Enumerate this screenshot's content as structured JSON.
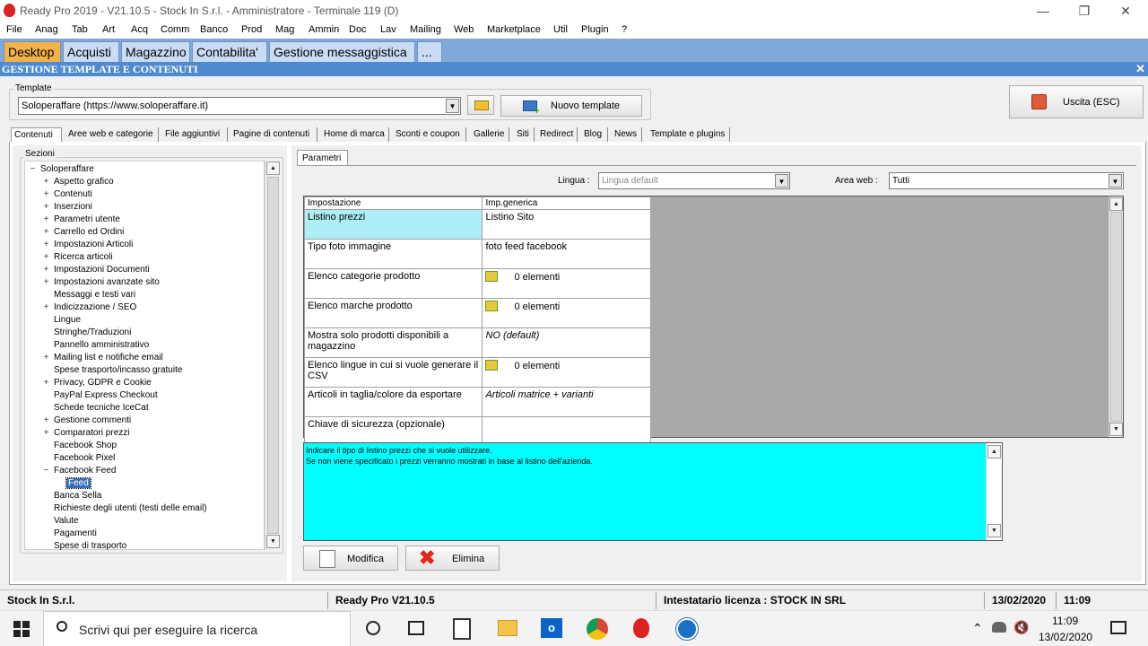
{
  "window": {
    "title": "Ready Pro 2019 - V21.10.5 - Stock In S.r.l. - Amministratore - Terminale 119 (D)",
    "controls": [
      "—",
      "❐",
      "✕"
    ]
  },
  "menu": [
    "File",
    "Anag",
    "Tab",
    "Art",
    "Acq",
    "Comm",
    "Banco",
    "Prod",
    "Mag",
    "Ammin",
    "Doc",
    "Lav",
    "Mailing",
    "Web",
    "Marketplace",
    "Util",
    "Plugin",
    "?"
  ],
  "module_tabs": [
    "Desktop",
    "Acquisti",
    "Magazzino",
    "Contabilita'",
    "Gestione messaggistica",
    "..."
  ],
  "section_title": "GESTIONE TEMPLATE E CONTENUTI",
  "close_symbol": "✕",
  "template": {
    "group_label": "Template",
    "selected": "Soloperaffare (https://www.soloperaffare.it)",
    "new_button": "Nuovo template"
  },
  "exit_button": "Uscita (ESC)",
  "page_tabs": [
    "Contenuti",
    "Aree web e categorie",
    "File aggiuntivi",
    "Pagine di contenuti",
    "Home di marca",
    "Sconti e coupon",
    "Gallerie",
    "Siti",
    "Redirect",
    "Blog",
    "News",
    "Template e plugins"
  ],
  "sections": {
    "label": "Sezioni",
    "root": "Soloperaffare",
    "items": [
      {
        "label": "Aspetto grafico",
        "expand": "+"
      },
      {
        "label": "Contenuti",
        "expand": "+"
      },
      {
        "label": "Inserzioni",
        "expand": "+"
      },
      {
        "label": "Parametri utente",
        "expand": "+"
      },
      {
        "label": "Carrello ed Ordini",
        "expand": "+"
      },
      {
        "label": "Impostazioni Articoli",
        "expand": "+"
      },
      {
        "label": "Ricerca articoli",
        "expand": "+"
      },
      {
        "label": "Impostazioni Documenti",
        "expand": "+"
      },
      {
        "label": "Impostazioni avanzate sito",
        "expand": "+"
      },
      {
        "label": "Messaggi e testi vari",
        "expand": ""
      },
      {
        "label": "Indicizzazione / SEO",
        "expand": "+"
      },
      {
        "label": "Lingue",
        "expand": ""
      },
      {
        "label": "Stringhe/Traduzioni",
        "expand": ""
      },
      {
        "label": "Pannello amministrativo",
        "expand": ""
      },
      {
        "label": "Mailing list e notifiche email",
        "expand": "+"
      },
      {
        "label": "Spese trasporto/incasso gratuite",
        "expand": ""
      },
      {
        "label": "Privacy, GDPR e Cookie",
        "expand": "+"
      },
      {
        "label": "PayPal Express Checkout",
        "expand": ""
      },
      {
        "label": "Schede tecniche IceCat",
        "expand": ""
      },
      {
        "label": "Gestione commenti",
        "expand": "+"
      },
      {
        "label": "Comparatori prezzi",
        "expand": "+"
      },
      {
        "label": "Facebook Shop",
        "expand": ""
      },
      {
        "label": "Facebook Pixel",
        "expand": ""
      },
      {
        "label": "Facebook Feed",
        "expand": "−"
      },
      {
        "label": "Feed",
        "expand": "",
        "child": true,
        "selected": true
      },
      {
        "label": "Banca Sella",
        "expand": ""
      },
      {
        "label": "Richieste degli utenti (testi delle email)",
        "expand": ""
      },
      {
        "label": "Valute",
        "expand": ""
      },
      {
        "label": "Pagamenti",
        "expand": ""
      },
      {
        "label": "Spese di trasporto",
        "expand": ""
      }
    ]
  },
  "params": {
    "tab": "Parametri",
    "lingua_label": "Lingua :",
    "lingua_value": "Lingua default",
    "area_label": "Area web :",
    "area_value": "Tutti",
    "columns": [
      "Impostazione",
      "Imp.generica"
    ],
    "rows": [
      {
        "setting": "Listino prezzi",
        "value": "Listino Sito",
        "italic": false,
        "icon": false,
        "highlight": true
      },
      {
        "setting": "Tipo foto immagine",
        "value": "foto feed facebook",
        "italic": false,
        "icon": false,
        "highlight": false
      },
      {
        "setting": "Elenco categorie prodotto",
        "value": "0 elementi",
        "italic": false,
        "icon": true,
        "highlight": false
      },
      {
        "setting": "Elenco marche prodotto",
        "value": "0 elementi",
        "italic": false,
        "icon": true,
        "highlight": false
      },
      {
        "setting": "Mostra solo prodotti disponibili a magazzino",
        "value": "NO (default)",
        "italic": true,
        "icon": false,
        "highlight": false
      },
      {
        "setting": "Elenco lingue in cui si vuole generare il CSV",
        "value": "0 elementi",
        "italic": false,
        "icon": true,
        "highlight": false
      },
      {
        "setting": "Articoli in taglia/colore da esportare",
        "value": "Articoli matrice + varianti",
        "italic": true,
        "icon": false,
        "highlight": false
      },
      {
        "setting": "Chiave di sicurezza (opzionale)",
        "value": "",
        "italic": false,
        "icon": false,
        "highlight": false
      }
    ],
    "description_line1": "Indicare il tipo di listino prezzi che si vuole utilizzare.",
    "description_line2": "Se non viene specificato i prezzi verranno mostrati in base al listino dell'azienda.",
    "modify_button": "Modifica",
    "delete_button": "Elimina"
  },
  "status": {
    "company": "Stock In S.r.l.",
    "version": "Ready Pro V21.10.5",
    "license": "Intestatario licenza : STOCK IN SRL",
    "date": "13/02/2020",
    "time": "11:09"
  },
  "taskbar": {
    "search_placeholder": "Scrivi qui per eseguire la ricerca",
    "clock_time": "11:09",
    "clock_date": "13/02/2020"
  },
  "colors": {
    "module_bar": "#7fa7d8",
    "active_tab": "#f3b24a",
    "header_bar": "#4f8ad0",
    "highlight_cell": "#aeeef6",
    "description_bg": "#00ffff",
    "grid_empty": "#a9a9a9"
  }
}
